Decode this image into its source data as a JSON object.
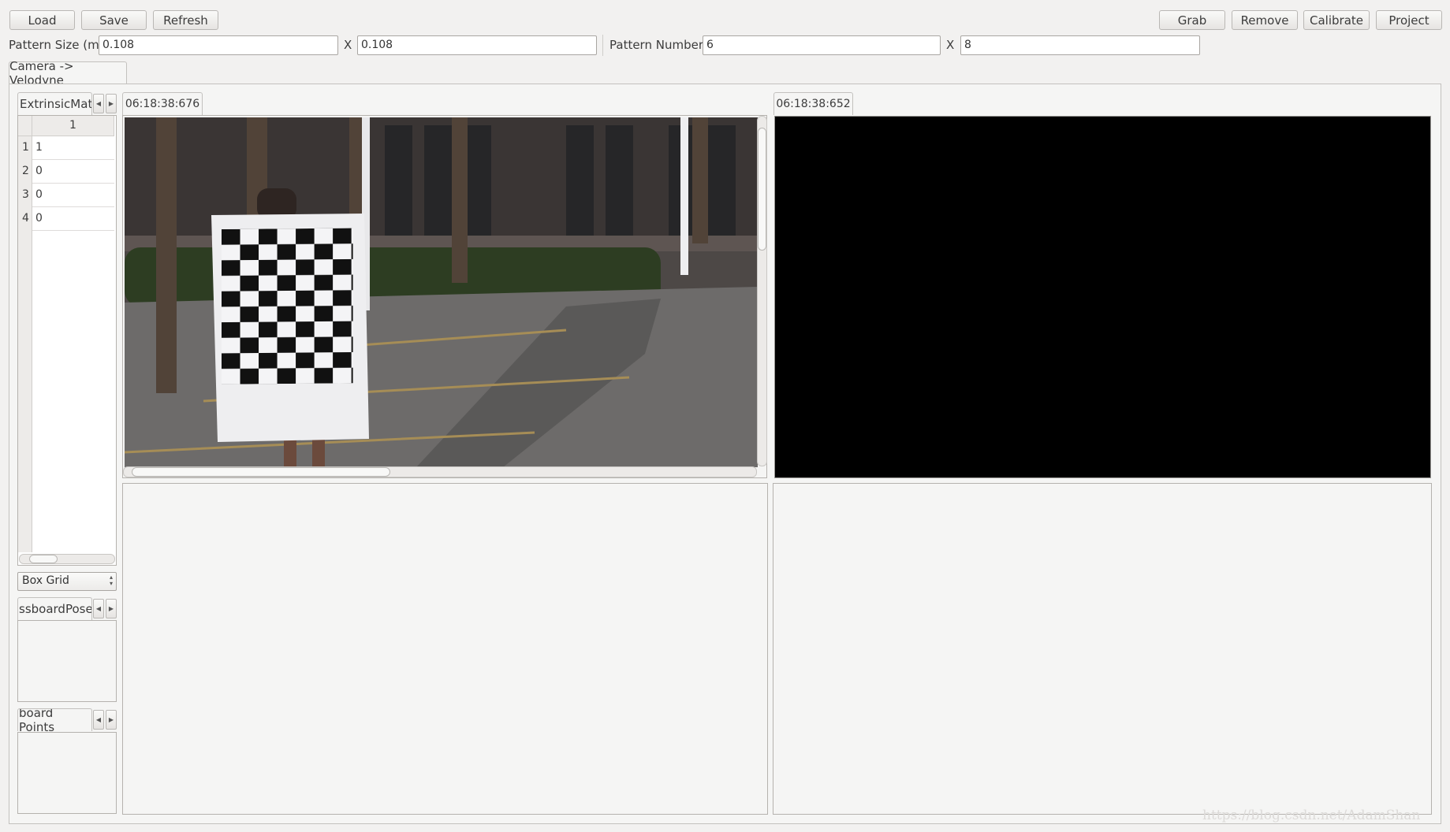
{
  "toolbar": {
    "load_label": "Load",
    "save_label": "Save",
    "refresh_label": "Refresh",
    "grab_label": "Grab",
    "remove_label": "Remove",
    "calibrate_label": "Calibrate",
    "project_label": "Project"
  },
  "pattern": {
    "size_label": "Pattern Size (m)",
    "size_x": "0.108",
    "size_sep": "X",
    "size_y": "0.108",
    "number_label": "Pattern Number",
    "number_x": "6",
    "number_sep": "X",
    "number_y": "8"
  },
  "main_tab": {
    "label": "Camera -> Velodyne"
  },
  "side": {
    "extrinsic_tab": "ExtrinsicMat",
    "table_column": "1",
    "rows": [
      {
        "index": "1",
        "value": "1"
      },
      {
        "index": "2",
        "value": "0"
      },
      {
        "index": "3",
        "value": "0"
      },
      {
        "index": "4",
        "value": "0"
      }
    ],
    "combo_value": "Box Grid",
    "pose_tab": "ssboardPose",
    "points_tab": "board Points"
  },
  "views": {
    "left_timestamp": "06:18:38:676",
    "right_timestamp": "06:18:38:652"
  },
  "watermark": "https://blog.csdn.net/AdamShan"
}
